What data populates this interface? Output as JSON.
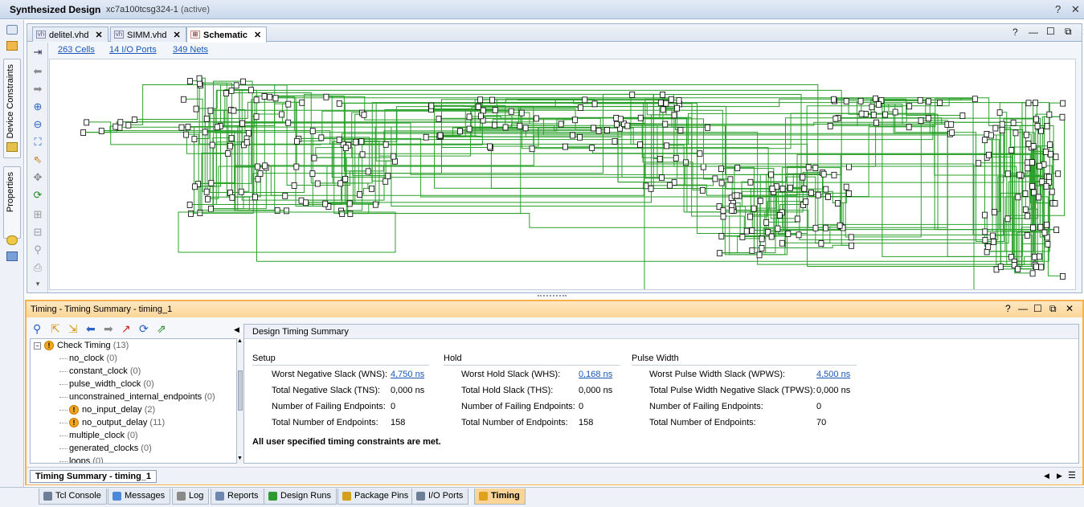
{
  "window": {
    "title": "Synthesized Design",
    "part": "xc7a100tcsg324-1",
    "state": "(active)"
  },
  "window_controls": {
    "help": "?",
    "close": "✕"
  },
  "left_tabs": {
    "device_constraints": "Device Constraints",
    "properties": "Properties"
  },
  "editor": {
    "tabs": [
      {
        "label": "delitel.vhd",
        "icon": "vhdl-file-icon"
      },
      {
        "label": "SIMM.vhd",
        "icon": "vhdl-file-icon"
      },
      {
        "label": "Schematic",
        "icon": "schematic-icon"
      }
    ],
    "close_glyph": "✕",
    "controls": {
      "help": "?",
      "minimize": "—",
      "maximize": "☐",
      "float": "⧉",
      "close": "✕"
    },
    "links": {
      "cells": "263 Cells",
      "io_ports": "14 I/O Ports",
      "nets": "349 Nets"
    }
  },
  "timing": {
    "panel_title": "Timing - Timing Summary - timing_1",
    "controls": {
      "help": "?",
      "minimize": "—",
      "restore": "☐",
      "float": "⧉",
      "close": "✕"
    },
    "tree": [
      {
        "label": "Check Timing",
        "count": "(13)",
        "warn": true,
        "level": 0
      },
      {
        "label": "no_clock",
        "count": "(0)",
        "warn": false,
        "level": 1
      },
      {
        "label": "constant_clock",
        "count": "(0)",
        "warn": false,
        "level": 1
      },
      {
        "label": "pulse_width_clock",
        "count": "(0)",
        "warn": false,
        "level": 1
      },
      {
        "label": "unconstrained_internal_endpoints",
        "count": "(0)",
        "warn": false,
        "level": 1
      },
      {
        "label": "no_input_delay",
        "count": "(2)",
        "warn": true,
        "level": 1
      },
      {
        "label": "no_output_delay",
        "count": "(11)",
        "warn": true,
        "level": 1
      },
      {
        "label": "multiple_clock",
        "count": "(0)",
        "warn": false,
        "level": 1
      },
      {
        "label": "generated_clocks",
        "count": "(0)",
        "warn": false,
        "level": 1
      },
      {
        "label": "loops",
        "count": "(0)",
        "warn": false,
        "level": 1
      }
    ],
    "summary_title": "Design Timing Summary",
    "setup": {
      "heading": "Setup",
      "rows": [
        {
          "label": "Worst Negative Slack (WNS):",
          "value": "4,750 ns",
          "link": true
        },
        {
          "label": "Total Negative Slack (TNS):",
          "value": "0,000 ns",
          "link": false
        },
        {
          "label": "Number of Failing Endpoints:",
          "value": "0",
          "link": false
        },
        {
          "label": "Total Number of Endpoints:",
          "value": "158",
          "link": false
        }
      ]
    },
    "hold": {
      "heading": "Hold",
      "rows": [
        {
          "label": "Worst Hold Slack (WHS):",
          "value": "0,168 ns",
          "link": true
        },
        {
          "label": "Total Hold Slack (THS):",
          "value": "0,000 ns",
          "link": false
        },
        {
          "label": "Number of Failing Endpoints:",
          "value": "0",
          "link": false
        },
        {
          "label": "Total Number of Endpoints:",
          "value": "158",
          "link": false
        }
      ]
    },
    "pulse": {
      "heading": "Pulse Width",
      "rows": [
        {
          "label": "Worst Pulse Width Slack (WPWS):",
          "value": "4,500 ns",
          "link": true
        },
        {
          "label": "Total Pulse Width Negative Slack (TPWS):",
          "value": "0,000 ns",
          "link": false
        },
        {
          "label": "Number of Failing Endpoints:",
          "value": "0",
          "link": false
        },
        {
          "label": "Total Number of Endpoints:",
          "value": "70",
          "link": false
        }
      ]
    },
    "message": "All user specified timing constraints are met.",
    "bottom_label": "Timing Summary - timing_1"
  },
  "bottom_tabs": [
    "Tcl Console",
    "Messages",
    "Log",
    "Reports",
    "Design Runs",
    "Package Pins",
    "I/O Ports",
    "Timing"
  ],
  "colors": {
    "net": "#2aa02a",
    "accent": "#f5b24a",
    "link": "#1a57b8"
  }
}
